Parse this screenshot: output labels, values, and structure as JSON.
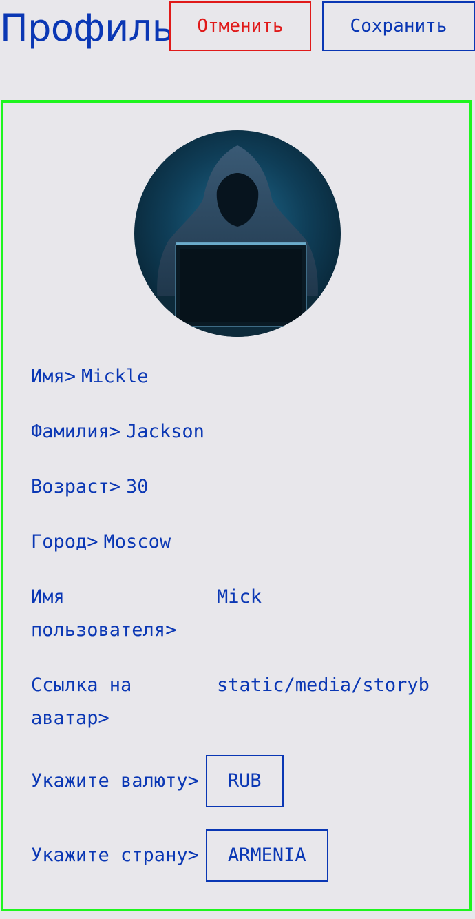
{
  "header": {
    "title": "Профиль",
    "cancel_label": "Отменить",
    "save_label": "Сохранить"
  },
  "colors": {
    "primary": "#0a37b4",
    "danger": "#e01a1a",
    "card_border": "#1ef51e",
    "background": "#e8e7eb"
  },
  "profile": {
    "avatar_icon": "hooded-hacker-avatar",
    "fields": {
      "first_name_label": "Имя>",
      "first_name_value": "Mickle",
      "last_name_label": "Фамилия>",
      "last_name_value": "Jackson",
      "age_label": "Возраст>",
      "age_value": "30",
      "city_label": "Город>",
      "city_value": "Moscow",
      "username_label": "Имя пользователя>",
      "username_value": "Mick",
      "avatar_link_label": "Ссылка на аватар>",
      "avatar_link_value": "static/media/storyb",
      "currency_label": "Укажите валюту>",
      "currency_value": "RUB",
      "country_label": "Укажите страну>",
      "country_value": "ARMENIA"
    }
  }
}
